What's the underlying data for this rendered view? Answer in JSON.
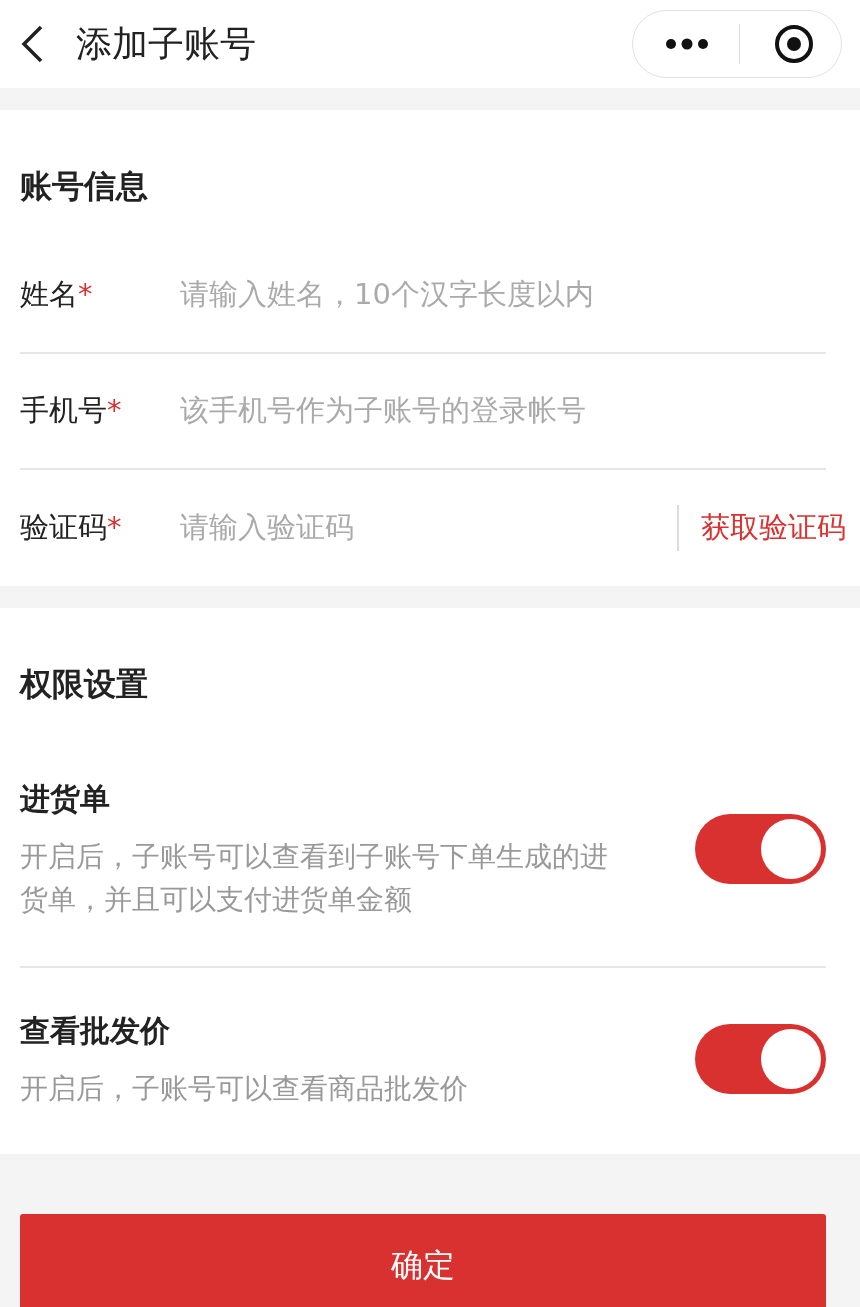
{
  "header": {
    "title": "添加子账号"
  },
  "account_section": {
    "title": "账号信息",
    "fields": [
      {
        "label": "姓名",
        "required_mark": "*",
        "placeholder": "请输入姓名，10个汉字长度以内"
      },
      {
        "label": "手机号",
        "required_mark": "*",
        "placeholder": "该手机号作为子账号的登录帐号"
      },
      {
        "label": "验证码",
        "required_mark": "*",
        "placeholder": "请输入验证码",
        "action": "获取验证码"
      }
    ]
  },
  "permission_section": {
    "title": "权限设置",
    "items": [
      {
        "title": "进货单",
        "description": "开启后，子账号可以查看到子账号下单生成的进货单，并且可以支付进货单金额",
        "on": true
      },
      {
        "title": "查看批发价",
        "description": "开启后，子账号可以查看商品批发价",
        "on": true
      }
    ]
  },
  "submit_button": "确定"
}
